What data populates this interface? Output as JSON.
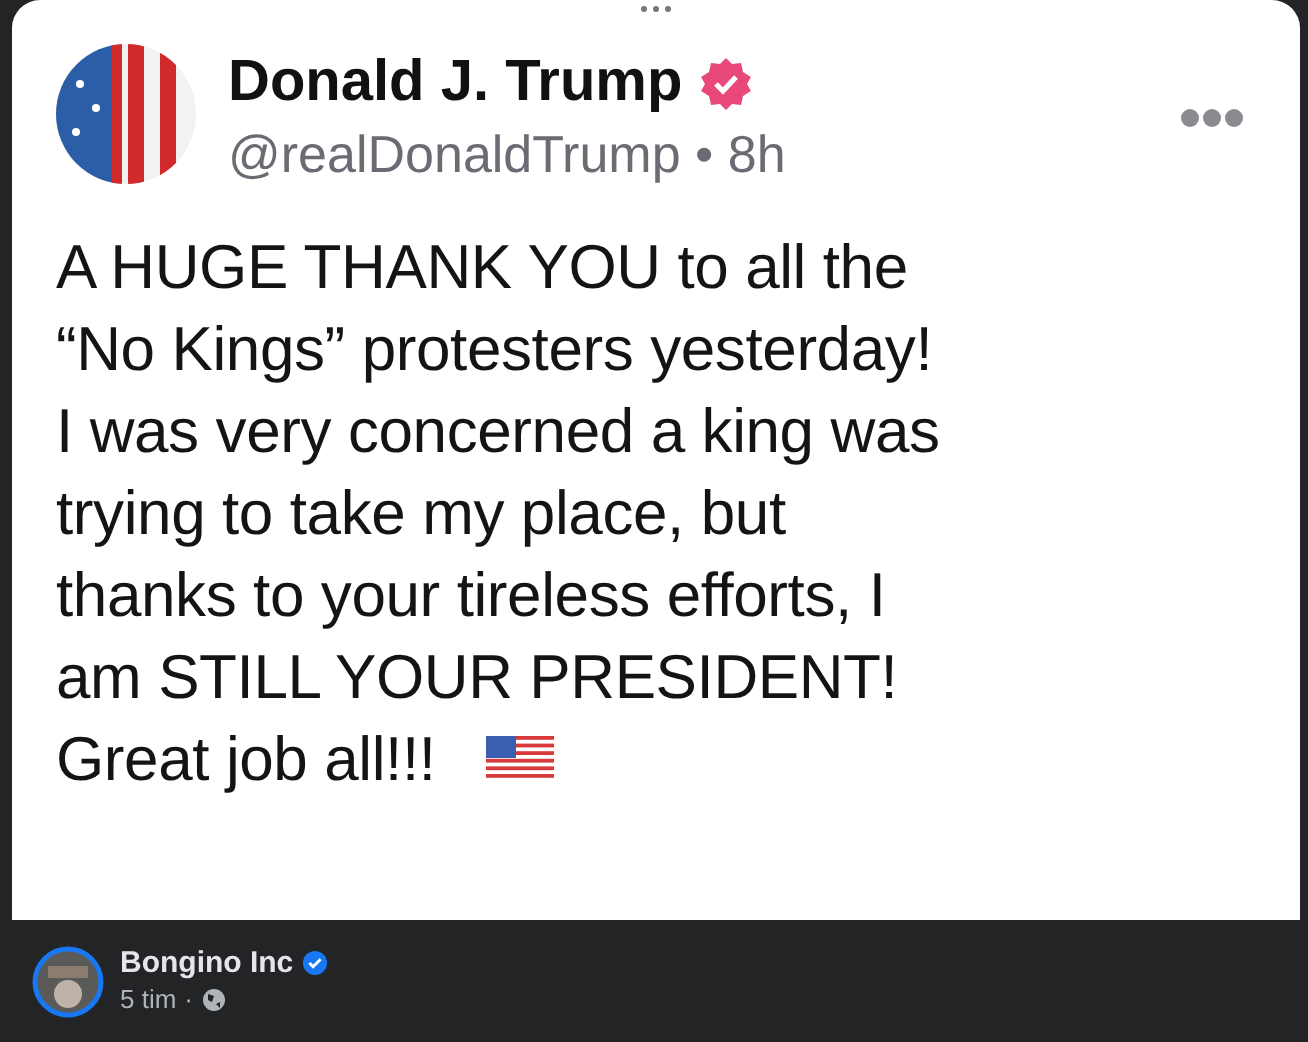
{
  "post": {
    "author": "Donald J. Trump",
    "verified": true,
    "handle": "@realDonaldTrump",
    "separator": "•",
    "time": "8h",
    "lines": [
      "A HUGE THANK YOU to all the",
      "“No Kings” protesters yesterday!",
      "I was very concerned a king was",
      "trying to take my place, but",
      "thanks to your tireless efforts, I",
      "am STILL YOUR PRESIDENT!",
      "Great job all!!!"
    ]
  },
  "footer": {
    "page_name": "Bongino Inc",
    "verified": true,
    "time": "5 tim",
    "separator": "·"
  }
}
